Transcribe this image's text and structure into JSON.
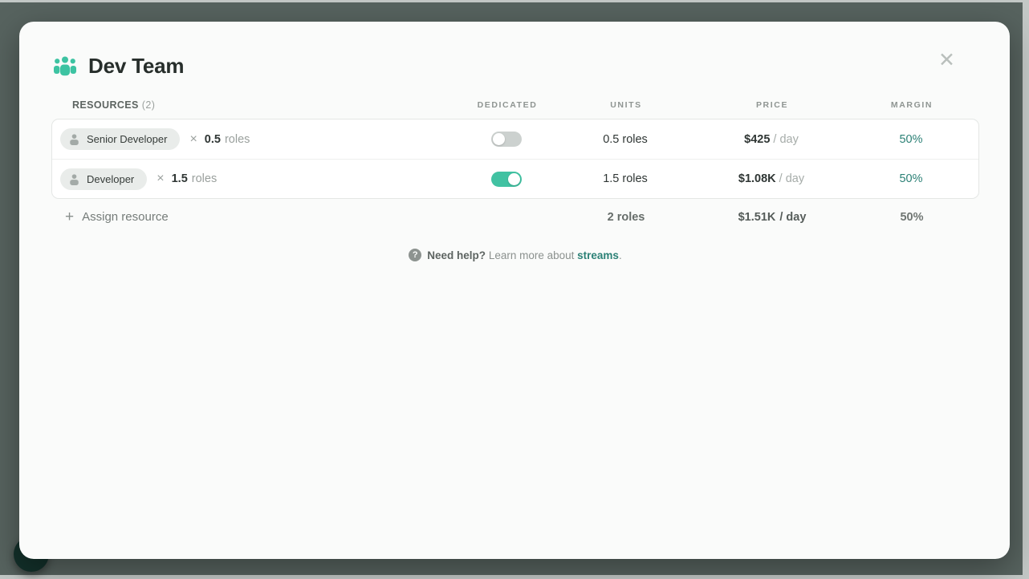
{
  "modal": {
    "title": "Dev Team",
    "close_glyph": "✕"
  },
  "resources_header": {
    "label": "RESOURCES",
    "count": "(2)"
  },
  "columns": {
    "dedicated": "DEDICATED",
    "units": "UNITS",
    "price": "PRICE",
    "margin": "MARGIN"
  },
  "rows": [
    {
      "name": "Senior Developer",
      "times_glyph": "×",
      "multiplier": "0.5",
      "multiplier_unit": "roles",
      "dedicated": false,
      "units": "0.5 roles",
      "price": "$425",
      "price_suffix": "/ day",
      "margin": "50%"
    },
    {
      "name": "Developer",
      "times_glyph": "×",
      "multiplier": "1.5",
      "multiplier_unit": "roles",
      "dedicated": true,
      "units": "1.5 roles",
      "price": "$1.08K",
      "price_suffix": "/ day",
      "margin": "50%"
    }
  ],
  "assign": {
    "plus_glyph": "+",
    "label": "Assign resource"
  },
  "totals": {
    "units": "2 roles",
    "price": "$1.51K",
    "price_suffix": "/ day",
    "margin": "50%"
  },
  "help": {
    "icon_glyph": "?",
    "bold": "Need help?",
    "text": "Learn more about",
    "link": "streams",
    "period": "."
  },
  "colors": {
    "accent": "#41c2a2",
    "accent_dark": "#2c8176",
    "backdrop": "#57635f"
  }
}
